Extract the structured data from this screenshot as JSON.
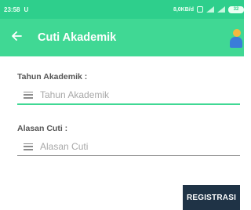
{
  "status_bar": {
    "time": "23:58",
    "carrier_glyph": "U",
    "net_speed": "8,0KB/d",
    "battery": "32"
  },
  "app_bar": {
    "title": "Cuti Akademik",
    "back_icon": "arrow-left-icon",
    "avatar_icon": "user-avatar-icon",
    "color": "#40d894"
  },
  "form": {
    "tahun": {
      "label": "Tahun Akademik :",
      "placeholder": "Tahun Akademik",
      "value": ""
    },
    "alasan": {
      "label": "Alasan Cuti :",
      "placeholder": "Alasan Cuti",
      "value": ""
    }
  },
  "actions": {
    "submit_label": "REGISTRASI",
    "submit_color": "#1f3346"
  }
}
